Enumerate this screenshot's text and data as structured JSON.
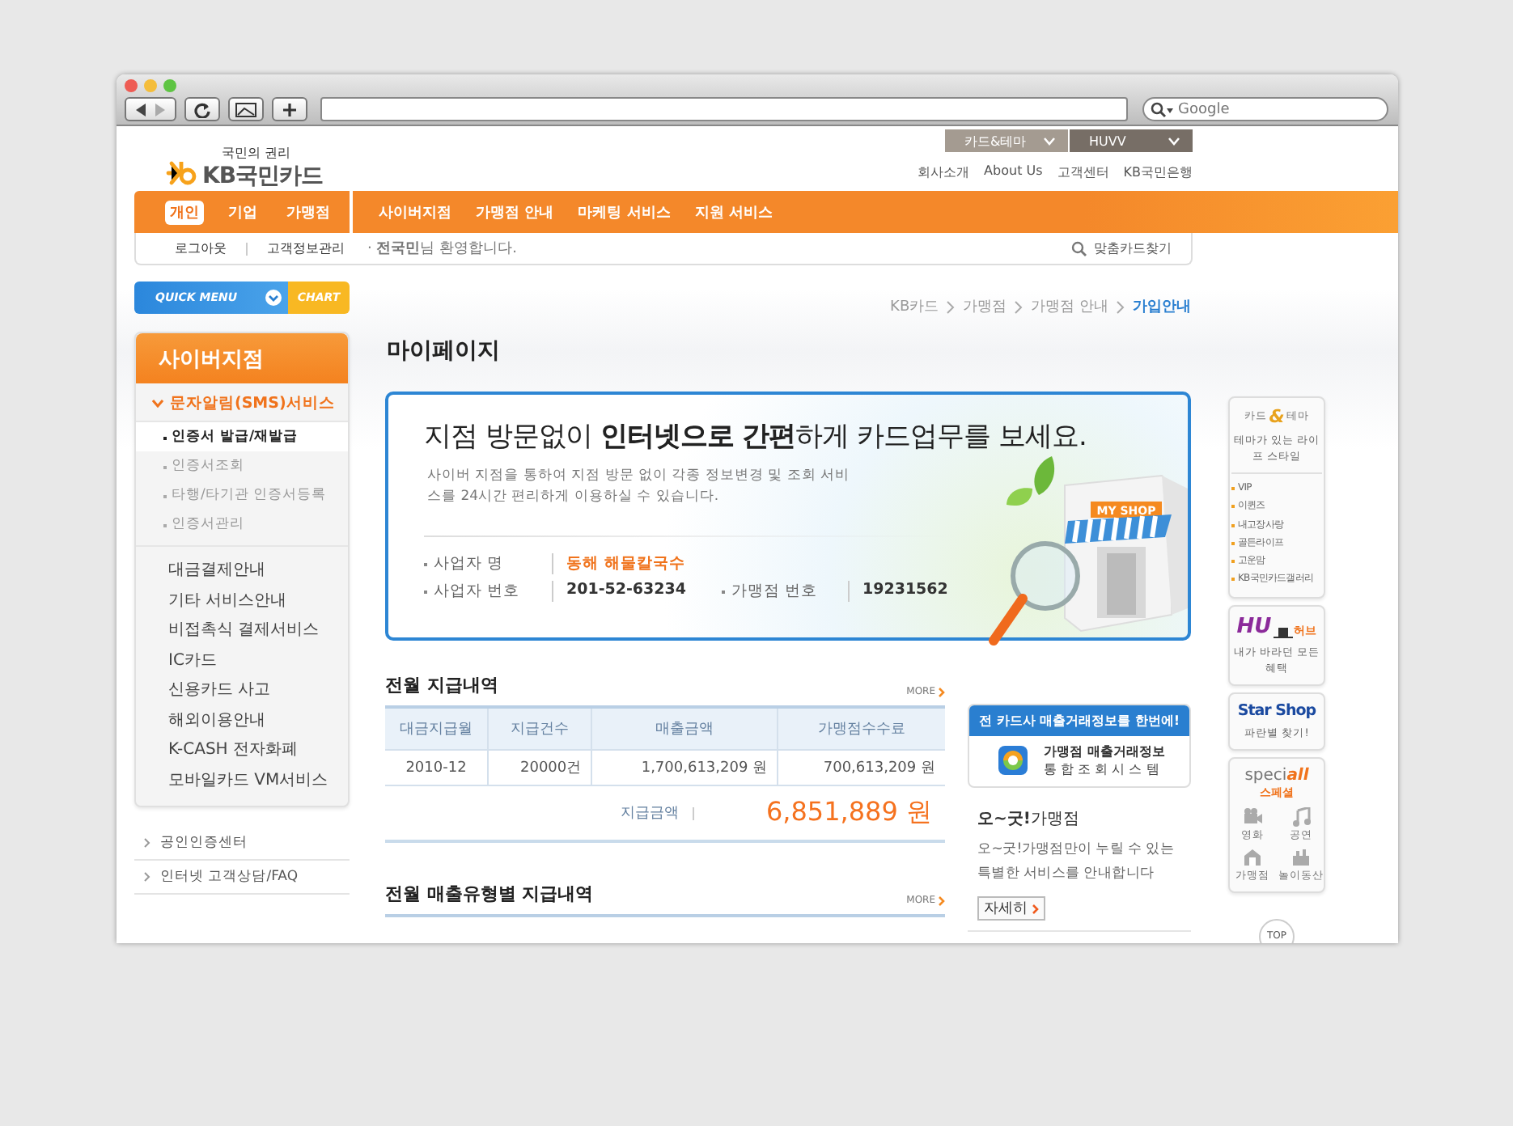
{
  "browser": {
    "search": {
      "placeholder": "Google"
    }
  },
  "header": {
    "logo": {
      "tagline": "국민의 권리",
      "name": "KB국민카드"
    },
    "top_tabs": [
      {
        "label": "카드&테마",
        "selected": false
      },
      {
        "label": "HUVV",
        "selected": true
      }
    ],
    "util_links": [
      "회사소개",
      "About Us",
      "고객센터",
      "KB국민은행"
    ]
  },
  "nav": {
    "segments": [
      {
        "label": "개인",
        "selected": true
      },
      {
        "label": "기업",
        "selected": false
      },
      {
        "label": "가맹점",
        "selected": false
      }
    ],
    "menu": [
      "사이버지점",
      "가맹점 안내",
      "마케팅 서비스",
      "지원 서비스"
    ]
  },
  "subbar": {
    "links": [
      "로그아웃",
      "고객정보관리"
    ],
    "welcome": "· **전국민**님 환영합니다.",
    "search_link": "맞춤카드찾기"
  },
  "sidebar": {
    "quick_menu": {
      "label": "QUICK MENU",
      "chart": "CHART"
    },
    "title": "사이버지점",
    "section": {
      "label": "문자알림(SMS)서비스",
      "expanded": true,
      "children": [
        {
          "label": "인증서 발급/재발급",
          "selected": true
        },
        {
          "label": "인증서조회",
          "selected": false
        },
        {
          "label": "타행/타기관 인증서등록",
          "selected": false
        },
        {
          "label": "인증서관리",
          "selected": false
        }
      ]
    },
    "items": [
      "대금결제안내",
      "기타 서비스안내",
      "비접촉식 결제서비스",
      "IC카드",
      "신용카드 사고",
      "해외이용안내",
      "K-CASH 전자화폐",
      "모바일카드 VM서비스"
    ],
    "links": [
      "공인인증센터",
      "인터넷 고객상담/FAQ"
    ]
  },
  "main": {
    "breadcrumb": [
      {
        "label": "KB카드",
        "current": false
      },
      {
        "label": "가맹점",
        "current": false
      },
      {
        "label": "가맹점 안내",
        "current": false
      },
      {
        "label": "가입안내",
        "current": true
      }
    ],
    "title": "마이페이지",
    "banner": {
      "headline": "지점 방문없이 **인터넷으로 간편**하게 카드업무를 보세요.",
      "description": "사이버 지점을 통하여 지점 방문 없이 각종 정보변경 및 조회 서비스를 24시간 편리하게 이용하실 수 있습니다.",
      "fields": [
        {
          "label": "사업자 명",
          "value": "동해 해물칼국수",
          "highlight": true
        },
        {
          "label": "사업자 번호",
          "value": "201-52-63234",
          "highlight": false
        },
        {
          "label": "가맹점 번호",
          "value": "19231562",
          "highlight": false
        }
      ],
      "sign": "MY SHOP"
    },
    "payments": {
      "title": "전월 지급내역",
      "more": "MORE",
      "columns": [
        "대금지급월",
        "지급건수",
        "매출금액",
        "가맹점수수료"
      ],
      "rows": [
        [
          "2010-12",
          "20000건",
          "1,700,613,209 원",
          "700,613,209 원"
        ]
      ],
      "total_label": "지급금액",
      "total": "6,851,889 원"
    },
    "payments_by_type": {
      "title": "전월 매출유형별 지급내역",
      "more": "MORE"
    },
    "promo": {
      "banner": "전 카드사 매출거래정보를 한번에!",
      "line_1": "가맹점 매출거래정보",
      "line_2": "통 합 조 회 시 스 템"
    },
    "good": {
      "title": "**오~굿!**가맹점",
      "text": "오~굿!가맹점만이 누릴 수 있는 특별한 서비스를 안내합니다",
      "button": "자세히"
    }
  },
  "quick": {
    "theme": {
      "logo_left": "카드",
      "logo_mid": "&",
      "logo_right": "테마",
      "desc": "테마가 있는 라이프 스타일",
      "links": [
        "VIP",
        "이퀸즈",
        "내고장사랑",
        "골든라이프",
        "고운맘",
        "KB국민카드갤러리"
      ]
    },
    "hub": {
      "logo": "HU",
      "sub": "허브",
      "desc": "내가 바라던 모든 혜택"
    },
    "starshop": {
      "title": "Star Shop",
      "desc": "파란별 찾기!"
    },
    "special": {
      "title_left": "speci",
      "title_right": "all",
      "sub": "스페셜",
      "items": [
        "영화",
        "공연",
        "가맹점",
        "놀이동산"
      ]
    },
    "top": "TOP"
  }
}
